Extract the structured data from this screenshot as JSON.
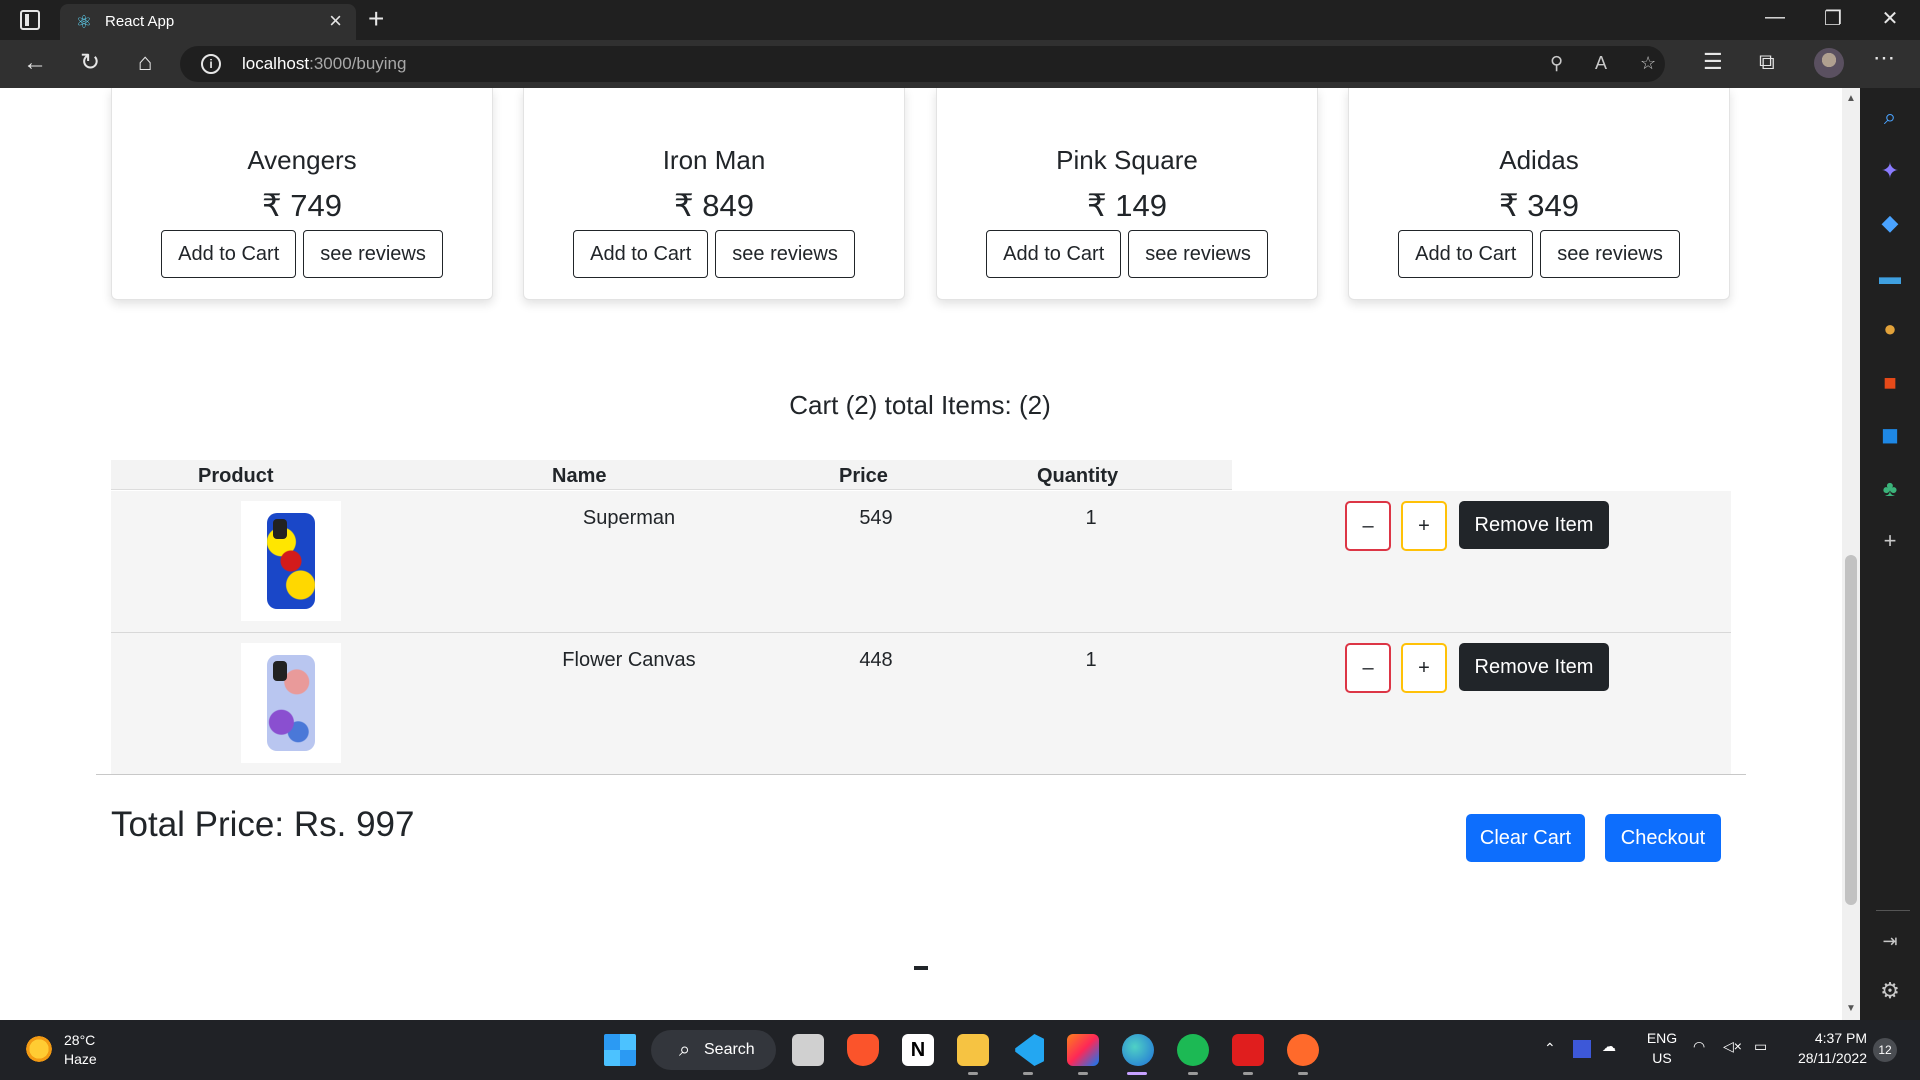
{
  "browser": {
    "tab_title": "React App",
    "url_host": "localhost",
    "url_rest": ":3000/buying",
    "new_tab_glyph": "+",
    "close_glyph": "×"
  },
  "products": [
    {
      "name": "Avengers",
      "price": "₹ 749",
      "add_label": "Add to Cart",
      "reviews_label": "see reviews"
    },
    {
      "name": "Iron Man",
      "price": "₹ 849",
      "add_label": "Add to Cart",
      "reviews_label": "see reviews"
    },
    {
      "name": "Pink Square",
      "price": "₹ 149",
      "add_label": "Add to Cart",
      "reviews_label": "see reviews"
    },
    {
      "name": "Adidas",
      "price": "₹ 349",
      "add_label": "Add to Cart",
      "reviews_label": "see reviews"
    }
  ],
  "cart": {
    "title": "Cart (2) total Items: (2)",
    "headers": [
      "Product",
      "Name",
      "Price",
      "Quantity"
    ],
    "rows": [
      {
        "name": "Superman",
        "price": "549",
        "quantity": "1",
        "minus": "–",
        "plus": "+",
        "remove": "Remove Item"
      },
      {
        "name": "Flower Canvas",
        "price": "448",
        "quantity": "1",
        "minus": "–",
        "plus": "+",
        "remove": "Remove Item"
      }
    ],
    "total": "Total Price: Rs. 997",
    "clear_label": "Clear Cart",
    "checkout_label": "Checkout"
  },
  "taskbar": {
    "temperature": "28°C",
    "weather": "Haze",
    "search_label": "Search",
    "lang": "ENG",
    "region": "US",
    "time": "4:37 PM",
    "date": "28/11/2022",
    "notifications": "12"
  },
  "colors": {
    "primary": "#0d6efd",
    "dark": "#212529",
    "danger": "#dc3545",
    "warning": "#ffc107"
  }
}
